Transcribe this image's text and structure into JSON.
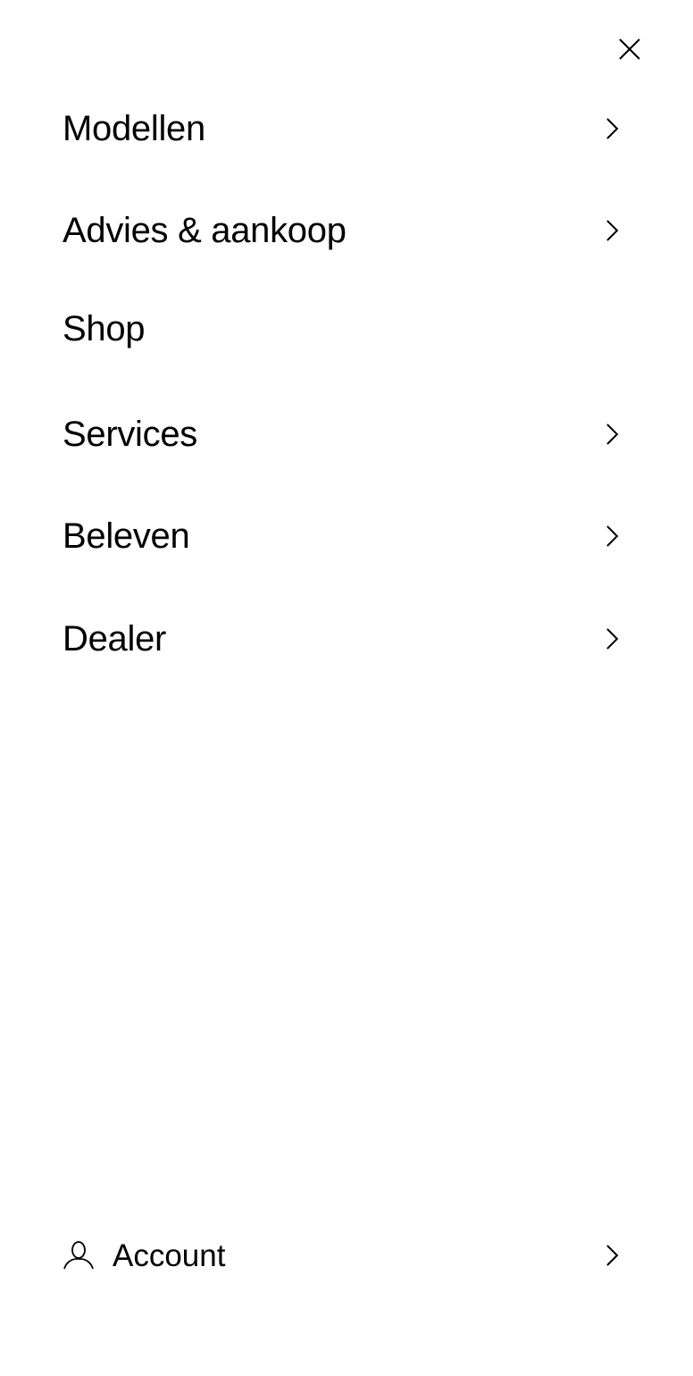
{
  "nav": {
    "close_icon": "close-icon",
    "items": [
      {
        "label": "Modellen",
        "has_submenu": true
      },
      {
        "label": "Advies & aankoop",
        "has_submenu": true
      },
      {
        "label": "Shop",
        "has_submenu": false
      },
      {
        "label": "Services",
        "has_submenu": true
      },
      {
        "label": "Beleven",
        "has_submenu": true
      },
      {
        "label": "Dealer",
        "has_submenu": true
      }
    ]
  },
  "account": {
    "label": "Account",
    "icon": "user-icon",
    "has_submenu": true
  },
  "colors": {
    "background": "#ffffff",
    "text": "#000000"
  }
}
